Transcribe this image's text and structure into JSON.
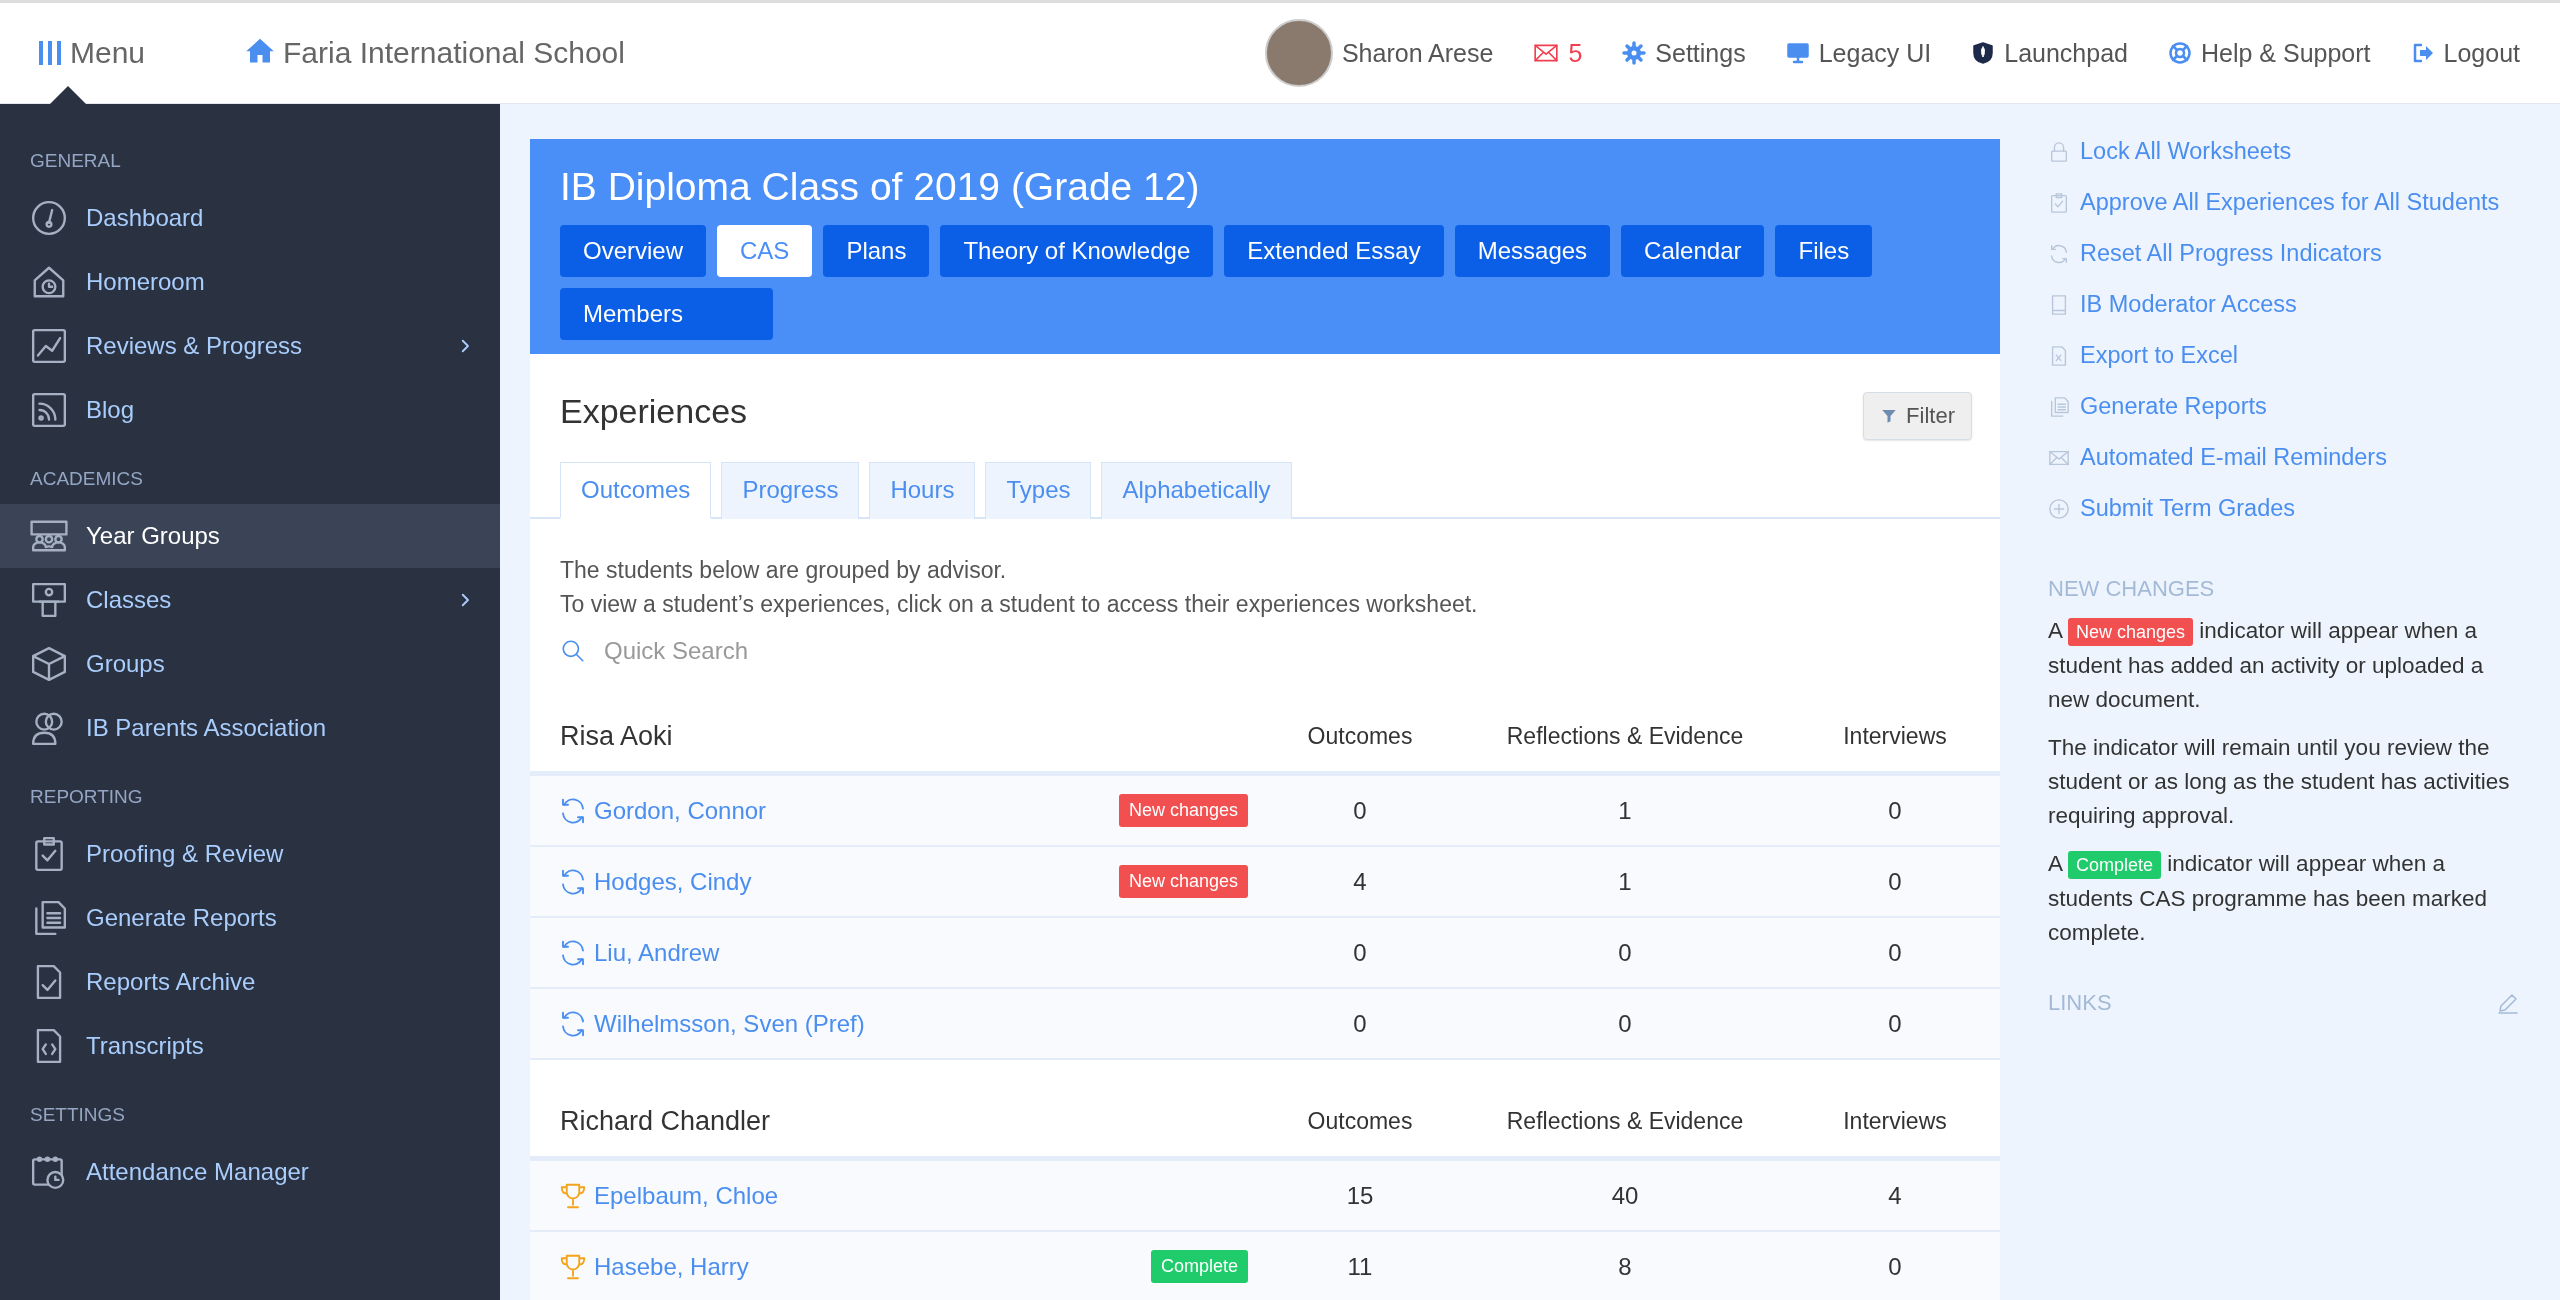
{
  "topbar": {
    "menu_label": "Menu",
    "school": "Faria International School",
    "user": "Sharon Arese",
    "mail_count": "5",
    "links": [
      {
        "label": "Settings"
      },
      {
        "label": "Legacy UI"
      },
      {
        "label": "Launchpad"
      },
      {
        "label": "Help & Support"
      },
      {
        "label": "Logout"
      }
    ]
  },
  "sidebar": {
    "sections": [
      {
        "title": "GENERAL",
        "items": [
          {
            "label": "Dashboard",
            "selected": false,
            "submenu": false
          },
          {
            "label": "Homeroom",
            "selected": false,
            "submenu": false
          },
          {
            "label": "Reviews & Progress",
            "selected": false,
            "submenu": true
          },
          {
            "label": "Blog",
            "selected": false,
            "submenu": false
          }
        ]
      },
      {
        "title": "ACADEMICS",
        "items": [
          {
            "label": "Year Groups",
            "selected": true,
            "submenu": false
          },
          {
            "label": "Classes",
            "selected": false,
            "submenu": true
          },
          {
            "label": "Groups",
            "selected": false,
            "submenu": false
          },
          {
            "label": "IB Parents Association",
            "selected": false,
            "submenu": false
          }
        ]
      },
      {
        "title": "REPORTING",
        "items": [
          {
            "label": "Proofing & Review",
            "selected": false,
            "submenu": false
          },
          {
            "label": "Generate Reports",
            "selected": false,
            "submenu": false
          },
          {
            "label": "Reports Archive",
            "selected": false,
            "submenu": false
          },
          {
            "label": "Transcripts",
            "selected": false,
            "submenu": false
          }
        ]
      },
      {
        "title": "SETTINGS",
        "items": [
          {
            "label": "Attendance Manager",
            "selected": false,
            "submenu": false
          }
        ]
      }
    ]
  },
  "header": {
    "title": "IB Diploma Class of 2019 (Grade 12)",
    "tabs": [
      {
        "label": "Overview",
        "selected": false
      },
      {
        "label": "CAS",
        "selected": true
      },
      {
        "label": "Plans",
        "selected": false
      },
      {
        "label": "Theory of Knowledge",
        "selected": false
      },
      {
        "label": "Extended Essay",
        "selected": false
      },
      {
        "label": "Messages",
        "selected": false
      },
      {
        "label": "Calendar",
        "selected": false
      },
      {
        "label": "Files",
        "selected": false
      },
      {
        "label": "Members",
        "selected": false
      }
    ]
  },
  "experiences": {
    "title": "Experiences",
    "filter_label": "Filter",
    "tabs": [
      {
        "label": "Outcomes",
        "selected": true
      },
      {
        "label": "Progress",
        "selected": false
      },
      {
        "label": "Hours",
        "selected": false
      },
      {
        "label": "Types",
        "selected": false
      },
      {
        "label": "Alphabetically",
        "selected": false
      }
    ],
    "intro": [
      "The students below are grouped by advisor.",
      "To view a student’s experiences, click on a student to access their experiences worksheet."
    ],
    "search": {
      "placeholder": "Quick Search"
    },
    "groups": [
      {
        "advisor": "Risa Aoki",
        "columns": [
          "Outcomes",
          "Reflections & Evidence",
          "Interviews"
        ],
        "rows": [
          {
            "kind": "progress",
            "name": "Gordon, Connor",
            "badge": {
              "kind": "new",
              "label": "New changes"
            },
            "values": [
              "0",
              "1",
              "0"
            ]
          },
          {
            "kind": "progress",
            "name": "Hodges, Cindy",
            "badge": {
              "kind": "new",
              "label": "New changes"
            },
            "values": [
              "4",
              "1",
              "0"
            ]
          },
          {
            "kind": "progress",
            "name": "Liu, Andrew",
            "values": [
              "0",
              "0",
              "0"
            ]
          },
          {
            "kind": "progress",
            "name": "Wilhelmsson, Sven (Pref)",
            "values": [
              "0",
              "0",
              "0"
            ]
          }
        ]
      },
      {
        "advisor": "Richard Chandler",
        "columns": [
          "Outcomes",
          "Reflections & Evidence",
          "Interviews"
        ],
        "rows": [
          {
            "kind": "trophy",
            "name": "Epelbaum, Chloe",
            "values": [
              "15",
              "40",
              "4"
            ]
          },
          {
            "kind": "trophy",
            "name": "Hasebe, Harry",
            "badge": {
              "kind": "complete",
              "label": "Complete"
            },
            "values": [
              "11",
              "8",
              "0"
            ]
          }
        ]
      }
    ]
  },
  "actions": [
    "Lock All Worksheets",
    "Approve All Experiences for All Students",
    "Reset All Progress Indicators",
    "IB Moderator Access",
    "Export to Excel",
    "Generate Reports",
    "Automated E-mail Reminders",
    "Submit Term Grades"
  ],
  "new_changes": {
    "title": "NEW CHANGES",
    "notes": [
      {
        "before": "A",
        "badge": {
          "kind": "new",
          "label": "New changes"
        },
        "after": "indicator will appear when a student has added an activity or uploaded a new document."
      },
      {
        "before": "The indicator will remain until you review the student or as long as the student has activities requiring approval."
      },
      {
        "before": "A",
        "badge": {
          "kind": "complete",
          "label": "Complete"
        },
        "after": "indicator will appear when a students CAS programme has been marked complete."
      }
    ]
  },
  "links": {
    "title": "LINKS"
  }
}
